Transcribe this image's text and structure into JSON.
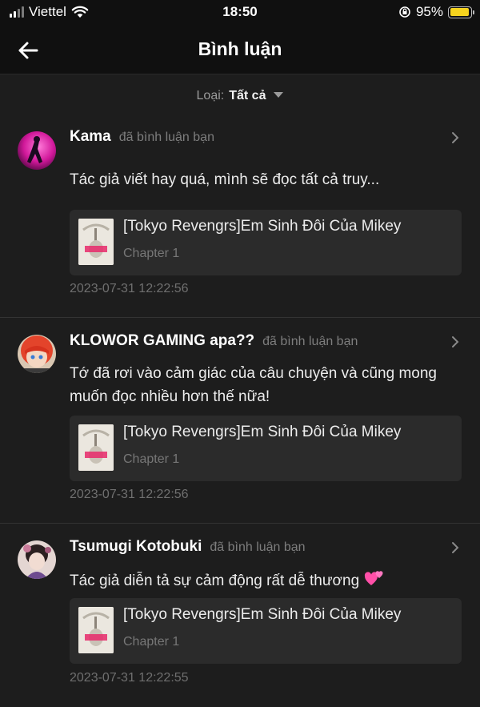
{
  "status_bar": {
    "carrier": "Viettel",
    "time": "18:50",
    "battery_percent": "95%",
    "battery_color": "#f6d31e"
  },
  "nav": {
    "back_icon": "arrow-left-icon",
    "title": "Bình luận"
  },
  "filter": {
    "label": "Loại:",
    "value": "Tất cả"
  },
  "comments": [
    {
      "name": "Kama",
      "action": "đã bình luận bạn",
      "text": "Tác giả viết hay quá, mình sẽ đọc tất cả truy...",
      "story_title": "[Tokyo Revengrs]Em Sinh Đôi Của Mikey",
      "chapter": "Chapter 1",
      "time": "2023-07-31 12:22:56"
    },
    {
      "name": "KLOWOR GAMING apa??",
      "action": "đã bình luận bạn",
      "text": "Tớ đã rơi vào cảm giác của câu chuyện và cũng mong muốn đọc nhiều hơn thế nữa!",
      "story_title": "[Tokyo Revengrs]Em Sinh Đôi Của Mikey",
      "chapter": "Chapter 1",
      "time": "2023-07-31 12:22:56"
    },
    {
      "name": "Tsumugi Kotobuki",
      "action": "đã bình luận bạn",
      "text": "Tác giả diễn tả sự cảm động rất dễ thương",
      "story_title": "[Tokyo Revengrs]Em Sinh Đôi Của Mikey",
      "chapter": "Chapter 1",
      "time": "2023-07-31 12:22:55"
    }
  ]
}
